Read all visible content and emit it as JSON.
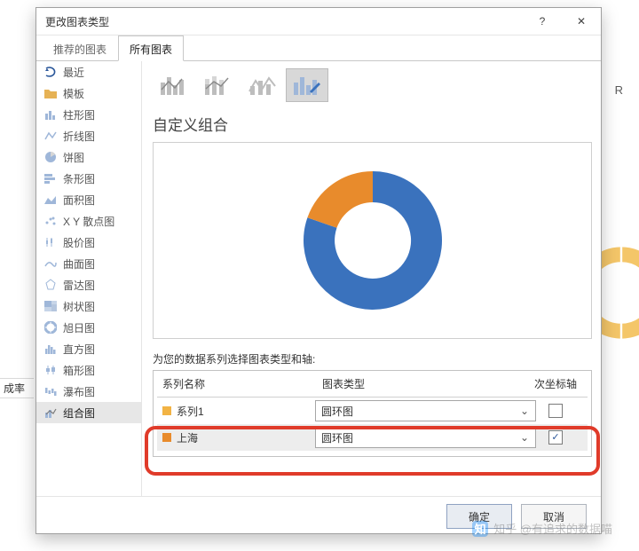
{
  "sheet": {
    "column_header": "R",
    "left_cell": "成率"
  },
  "dialog": {
    "title": "更改图表类型",
    "help": "?",
    "close": "✕",
    "tabs": {
      "recommended": "推荐的图表",
      "all": "所有图表"
    },
    "nav": [
      {
        "id": "recent",
        "label": "最近",
        "icon": "recent-icon"
      },
      {
        "id": "templates",
        "label": "模板",
        "icon": "folder-icon"
      },
      {
        "id": "column",
        "label": "柱形图",
        "icon": "column-icon"
      },
      {
        "id": "line",
        "label": "折线图",
        "icon": "line-icon"
      },
      {
        "id": "pie",
        "label": "饼图",
        "icon": "pie-icon"
      },
      {
        "id": "bar",
        "label": "条形图",
        "icon": "bar-icon"
      },
      {
        "id": "area",
        "label": "面积图",
        "icon": "area-icon"
      },
      {
        "id": "scatter",
        "label": "X Y 散点图",
        "icon": "scatter-icon"
      },
      {
        "id": "stock",
        "label": "股价图",
        "icon": "stock-icon"
      },
      {
        "id": "surface",
        "label": "曲面图",
        "icon": "surface-icon"
      },
      {
        "id": "radar",
        "label": "雷达图",
        "icon": "radar-icon"
      },
      {
        "id": "treemap",
        "label": "树状图",
        "icon": "treemap-icon"
      },
      {
        "id": "sunburst",
        "label": "旭日图",
        "icon": "sunburst-icon"
      },
      {
        "id": "histogram",
        "label": "直方图",
        "icon": "histogram-icon"
      },
      {
        "id": "boxwhisker",
        "label": "箱形图",
        "icon": "box-icon"
      },
      {
        "id": "waterfall",
        "label": "瀑布图",
        "icon": "waterfall-icon"
      },
      {
        "id": "combo",
        "label": "组合图",
        "icon": "combo-icon"
      }
    ],
    "section_title": "自定义组合",
    "series_hint": "为您的数据系列选择图表类型和轴:",
    "columns": {
      "name": "系列名称",
      "type": "图表类型",
      "axis": "次坐标轴"
    },
    "rows": [
      {
        "swatch": "#f2b344",
        "name": "系列1",
        "type": "圆环图",
        "secondary": false
      },
      {
        "swatch": "#e88b2c",
        "name": "上海",
        "type": "圆环图",
        "secondary": true
      }
    ],
    "buttons": {
      "ok": "确定",
      "cancel": "取消"
    }
  },
  "watermark": "知乎 @有追求的数据喵",
  "chart_data": {
    "type": "pie",
    "variant": "doughnut",
    "title": "",
    "series": [
      {
        "name": "系列1 - 蓝",
        "value": 84,
        "color": "#3a72bd"
      },
      {
        "name": "系列1 - 橙",
        "value": 16,
        "color": "#e88b2c"
      }
    ],
    "inner_radius_pct": 55
  }
}
